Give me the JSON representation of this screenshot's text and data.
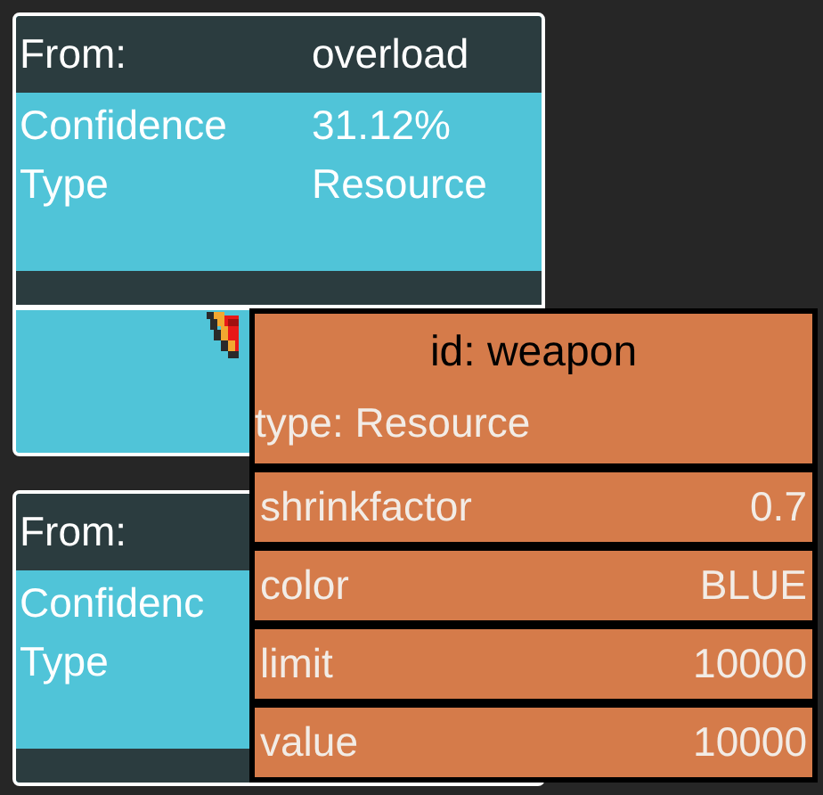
{
  "cards": [
    {
      "header": {
        "label": "From:",
        "value": "overload"
      },
      "rows": [
        {
          "label": "Confidence",
          "value": "31.12%"
        },
        {
          "label": "Type",
          "value": "Resource"
        }
      ],
      "kind": "sprite"
    },
    {
      "header": {
        "label": "From:"
      },
      "rows": [
        {
          "label": "Confidenc"
        },
        {
          "label": "Type"
        }
      ],
      "kind": "plain"
    }
  ],
  "tooltip": {
    "title": "id: weapon",
    "subtitle": "type: Resource",
    "properties": [
      {
        "name": "shrinkfactor",
        "value": "0.7"
      },
      {
        "name": "color",
        "value": "BLUE"
      },
      {
        "name": "limit",
        "value": "10000"
      },
      {
        "name": "value",
        "value": "10000"
      }
    ]
  }
}
